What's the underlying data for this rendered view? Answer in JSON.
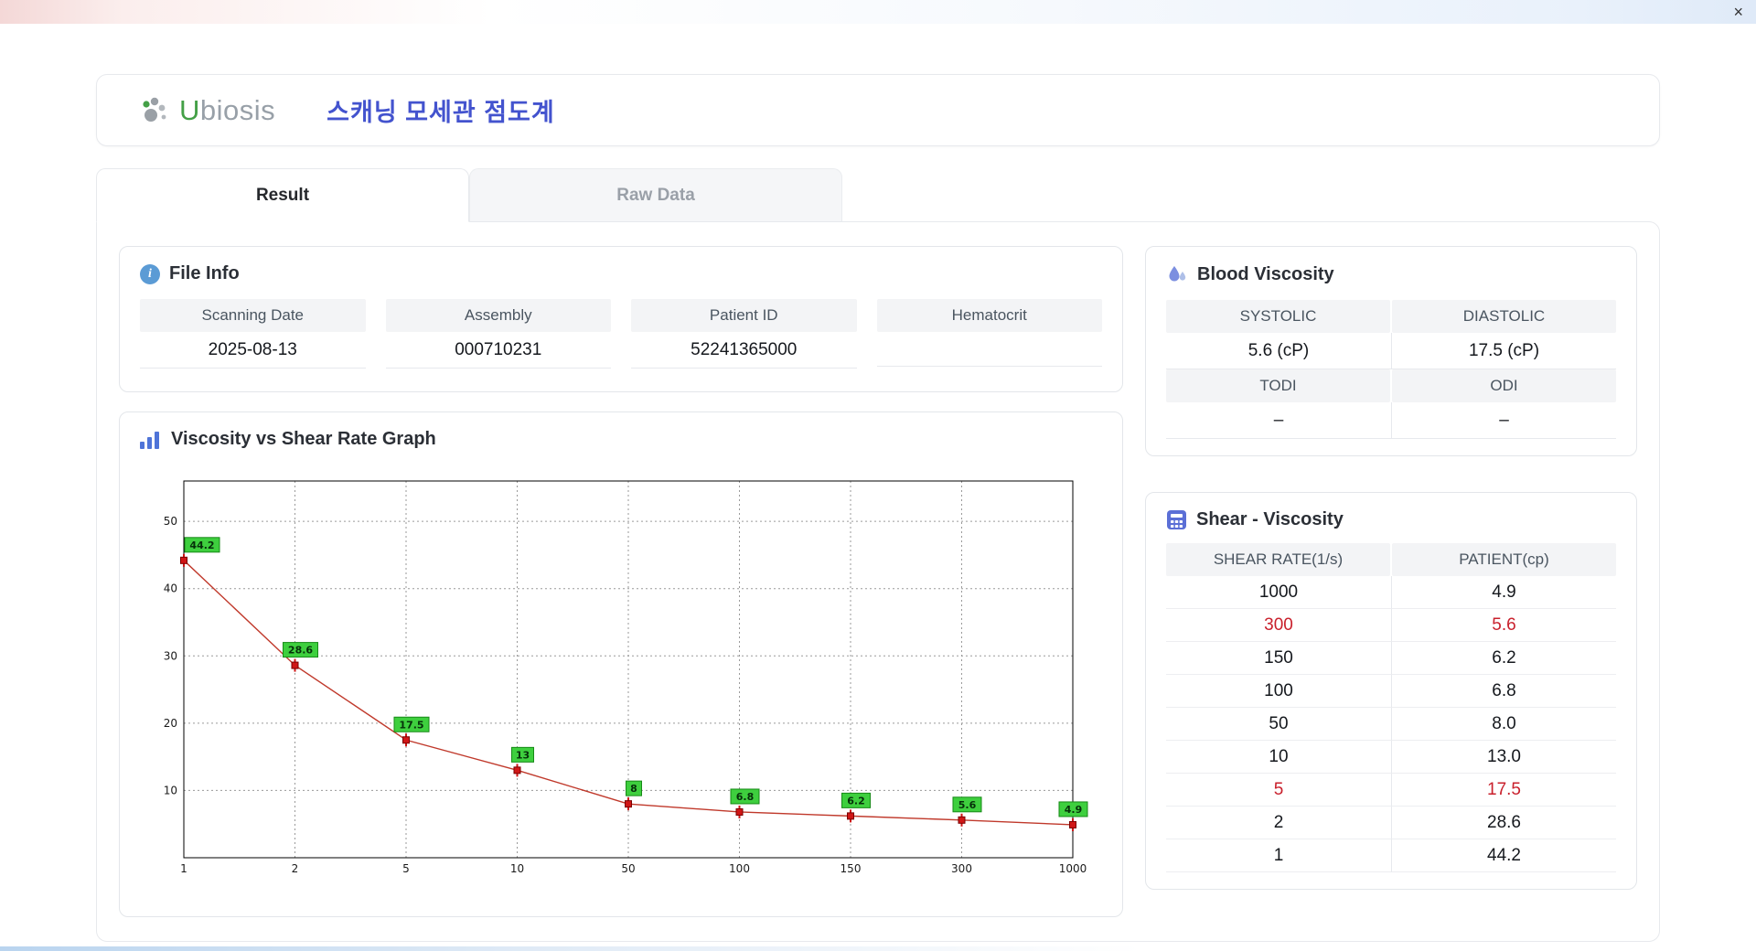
{
  "window": {
    "close_label": "×"
  },
  "header": {
    "logo_prefix": "U",
    "logo_suffix": "biosis",
    "title": "스캐닝 모세관 점도계"
  },
  "tabs": {
    "result": "Result",
    "raw_data": "Raw Data"
  },
  "file_info": {
    "title": "File Info",
    "fields": [
      {
        "label": "Scanning Date",
        "value": "2025-08-13"
      },
      {
        "label": "Assembly",
        "value": "000710231"
      },
      {
        "label": "Patient ID",
        "value": "52241365000"
      },
      {
        "label": "Hematocrit",
        "value": ""
      }
    ]
  },
  "blood_viscosity": {
    "title": "Blood Viscosity",
    "rows": [
      {
        "cols": [
          {
            "label": "SYSTOLIC",
            "value": "5.6 (cP)"
          },
          {
            "label": "DIASTOLIC",
            "value": "17.5 (cP)"
          }
        ]
      },
      {
        "cols": [
          {
            "label": "TODI",
            "value": "–"
          },
          {
            "label": "ODI",
            "value": "–"
          }
        ]
      }
    ]
  },
  "graph_panel": {
    "title": "Viscosity vs Shear Rate Graph"
  },
  "chart_data": {
    "type": "line",
    "title": "",
    "xlabel": "",
    "ylabel": "",
    "categories": [
      "1",
      "2",
      "5",
      "10",
      "50",
      "100",
      "150",
      "300",
      "1000"
    ],
    "values": [
      44.2,
      28.6,
      17.5,
      13,
      8,
      6.8,
      6.2,
      5.6,
      4.9
    ],
    "point_labels": [
      "44.2",
      "28.6",
      "17.5",
      "13",
      "8",
      "6.8",
      "6.2",
      "5.6",
      "4.9"
    ],
    "yticks": [
      10,
      20,
      30,
      40,
      50
    ],
    "ylim": [
      0,
      56
    ],
    "grid": "dotted",
    "line_color": "#c0392b",
    "marker_color": "#d01616",
    "label_bg": "#3ecf3e",
    "label_border": "#168a16"
  },
  "shear_table": {
    "title": "Shear - Viscosity",
    "headers": [
      "SHEAR RATE(1/s)",
      "PATIENT(cp)"
    ],
    "rows": [
      {
        "shear": "1000",
        "patient": "4.9",
        "highlight": false
      },
      {
        "shear": "300",
        "patient": "5.6",
        "highlight": true
      },
      {
        "shear": "150",
        "patient": "6.2",
        "highlight": false
      },
      {
        "shear": "100",
        "patient": "6.8",
        "highlight": false
      },
      {
        "shear": "50",
        "patient": "8.0",
        "highlight": false
      },
      {
        "shear": "10",
        "patient": "13.0",
        "highlight": false
      },
      {
        "shear": "5",
        "patient": "17.5",
        "highlight": true
      },
      {
        "shear": "2",
        "patient": "28.6",
        "highlight": false
      },
      {
        "shear": "1",
        "patient": "44.2",
        "highlight": false
      }
    ]
  }
}
